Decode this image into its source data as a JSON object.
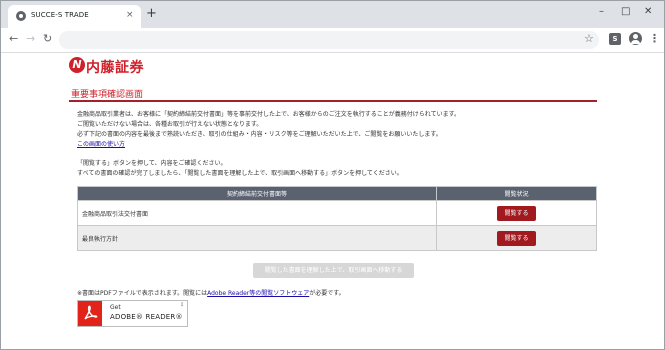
{
  "browser": {
    "tab_title": "SUCCE-S TRADE",
    "tab_close": "×",
    "new_tab": "+",
    "window_controls": [
      "–",
      "□",
      "✕"
    ],
    "back": "←",
    "forward": "→",
    "reload": "↻",
    "star": "☆",
    "extension": "S",
    "menu": "⋮"
  },
  "brand": {
    "logo_letter": "N",
    "logo_text": "内藤証券",
    "accent_color": "#d0202a"
  },
  "page": {
    "heading": "重要事項確認画面",
    "intro_lines": [
      "金融商品取引業者は、お客様に「契約締結前交付書面」等を事前交付した上で、お客様からのご注文を執行することが義務付けられています。",
      "ご閲覧いただけない場合は、各種お取引が行えない状態となります。",
      "必ず下記の書面の内容を最後まで熟読いただき、取引の仕組み・内容・リスク等をご理解いただいた上で、ご閲覧をお願いいたします。"
    ],
    "usage_link": "この画面の使い方",
    "instruction_lines": [
      "「閲覧する」ボタンを押して、内容をご確認ください。",
      "すべての書面の確認が完了しましたら、「閲覧した書面を理解した上で、取引画面へ移動する」ボタンを押してください。"
    ]
  },
  "table": {
    "headers": [
      "契約締結前交付書面等",
      "閲覧状況"
    ],
    "rows": [
      {
        "name": "金融商品取引法交付書面",
        "action": "閲覧する"
      },
      {
        "name": "最良執行方針",
        "action": "閲覧する"
      }
    ]
  },
  "proceed_button": "閲覧した書面を理解した上で、取引画面へ移動する",
  "pdf_note": {
    "prefix": "※書面はPDFファイルで表示されます。閲覧には",
    "link": "Adobe Reader等の閲覧ソフトウェア",
    "suffix": "が必要です。"
  },
  "adobe": {
    "get": "Get",
    "name": "ADOBE® READER®"
  }
}
